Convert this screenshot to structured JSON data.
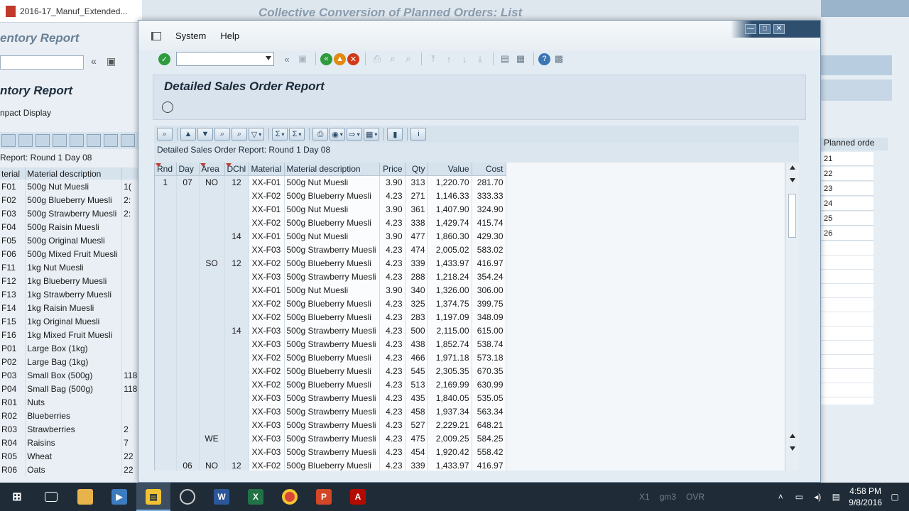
{
  "bg_left": {
    "pdf_tab_title": "2016-17_Manuf_Extended...",
    "title_inventory": "entory Report",
    "report_title": "ntory Report",
    "compact_display": "npact Display",
    "report_sub": "Report: Round 1 Day 08",
    "headers": [
      "terial",
      "Material description",
      ""
    ],
    "rows": [
      [
        "F01",
        "500g Nut Muesli",
        "1("
      ],
      [
        "F02",
        "500g Blueberry Muesli",
        "2:"
      ],
      [
        "F03",
        "500g Strawberry Muesli",
        "2:"
      ],
      [
        "F04",
        "500g Raisin Muesli",
        ""
      ],
      [
        "F05",
        "500g Original Muesli",
        ""
      ],
      [
        "F06",
        "500g Mixed Fruit Muesli",
        ""
      ],
      [
        "F11",
        "1kg Nut Muesli",
        ""
      ],
      [
        "F12",
        "1kg Blueberry Muesli",
        ""
      ],
      [
        "F13",
        "1kg Strawberry Muesli",
        ""
      ],
      [
        "F14",
        "1kg Raisin Muesli",
        ""
      ],
      [
        "F15",
        "1kg Original Muesli",
        ""
      ],
      [
        "F16",
        "1kg Mixed Fruit Muesli",
        ""
      ],
      [
        "P01",
        "Large Box (1kg)",
        ""
      ],
      [
        "P02",
        "Large Bag (1kg)",
        ""
      ],
      [
        "P03",
        "Small Box (500g)",
        "118"
      ],
      [
        "P04",
        "Small Bag (500g)",
        "118"
      ],
      [
        "R01",
        "Nuts",
        ""
      ],
      [
        "R02",
        "Blueberries",
        ""
      ],
      [
        "R03",
        "Strawberries",
        "2"
      ],
      [
        "R04",
        "Raisins",
        "7"
      ],
      [
        "R05",
        "Wheat",
        "22"
      ],
      [
        "R06",
        "Oats",
        "22"
      ]
    ]
  },
  "bg_top": {
    "title": "Collective Conversion of Planned Orders: List"
  },
  "bg_right": {
    "header": "Planned orde",
    "values": [
      "21",
      "22",
      "23",
      "24",
      "25",
      "26"
    ]
  },
  "dialog": {
    "menu": {
      "system": "System",
      "help": "Help"
    },
    "report_title": "Detailed Sales Order Report",
    "report_sub": "Detailed Sales Order Report: Round 1 Day 08",
    "columns": [
      "Rnd",
      "Day",
      "Area",
      "DChl",
      "Material",
      "Material description",
      "Price",
      "Qty",
      "Value",
      "Cost"
    ],
    "rows": [
      [
        "1",
        "07",
        "NO",
        "12",
        "XX-F01",
        "500g Nut Muesli",
        "3.90",
        "313",
        "1,220.70",
        "281.70"
      ],
      [
        "",
        "",
        "",
        "",
        "XX-F02",
        "500g Blueberry Muesli",
        "4.23",
        "271",
        "1,146.33",
        "333.33"
      ],
      [
        "",
        "",
        "",
        "",
        "XX-F01",
        "500g Nut Muesli",
        "3.90",
        "361",
        "1,407.90",
        "324.90"
      ],
      [
        "",
        "",
        "",
        "",
        "XX-F02",
        "500g Blueberry Muesli",
        "4.23",
        "338",
        "1,429.74",
        "415.74"
      ],
      [
        "",
        "",
        "",
        "14",
        "XX-F01",
        "500g Nut Muesli",
        "3.90",
        "477",
        "1,860.30",
        "429.30"
      ],
      [
        "",
        "",
        "",
        "",
        "XX-F03",
        "500g Strawberry Muesli",
        "4.23",
        "474",
        "2,005.02",
        "583.02"
      ],
      [
        "",
        "",
        "SO",
        "12",
        "XX-F02",
        "500g Blueberry Muesli",
        "4.23",
        "339",
        "1,433.97",
        "416.97"
      ],
      [
        "",
        "",
        "",
        "",
        "XX-F03",
        "500g Strawberry Muesli",
        "4.23",
        "288",
        "1,218.24",
        "354.24"
      ],
      [
        "",
        "",
        "",
        "",
        "XX-F01",
        "500g Nut Muesli",
        "3.90",
        "340",
        "1,326.00",
        "306.00"
      ],
      [
        "",
        "",
        "",
        "",
        "XX-F02",
        "500g Blueberry Muesli",
        "4.23",
        "325",
        "1,374.75",
        "399.75"
      ],
      [
        "",
        "",
        "",
        "",
        "XX-F02",
        "500g Blueberry Muesli",
        "4.23",
        "283",
        "1,197.09",
        "348.09"
      ],
      [
        "",
        "",
        "",
        "14",
        "XX-F03",
        "500g Strawberry Muesli",
        "4.23",
        "500",
        "2,115.00",
        "615.00"
      ],
      [
        "",
        "",
        "",
        "",
        "XX-F03",
        "500g Strawberry Muesli",
        "4.23",
        "438",
        "1,852.74",
        "538.74"
      ],
      [
        "",
        "",
        "",
        "",
        "XX-F02",
        "500g Blueberry Muesli",
        "4.23",
        "466",
        "1,971.18",
        "573.18"
      ],
      [
        "",
        "",
        "",
        "",
        "XX-F02",
        "500g Blueberry Muesli",
        "4.23",
        "545",
        "2,305.35",
        "670.35"
      ],
      [
        "",
        "",
        "",
        "",
        "XX-F02",
        "500g Blueberry Muesli",
        "4.23",
        "513",
        "2,169.99",
        "630.99"
      ],
      [
        "",
        "",
        "",
        "",
        "XX-F03",
        "500g Strawberry Muesli",
        "4.23",
        "435",
        "1,840.05",
        "535.05"
      ],
      [
        "",
        "",
        "",
        "",
        "XX-F03",
        "500g Strawberry Muesli",
        "4.23",
        "458",
        "1,937.34",
        "563.34"
      ],
      [
        "",
        "",
        "",
        "",
        "XX-F03",
        "500g Strawberry Muesli",
        "4.23",
        "527",
        "2,229.21",
        "648.21"
      ],
      [
        "",
        "",
        "WE",
        "",
        "XX-F03",
        "500g Strawberry Muesli",
        "4.23",
        "475",
        "2,009.25",
        "584.25"
      ],
      [
        "",
        "",
        "",
        "",
        "XX-F03",
        "500g Strawberry Muesli",
        "4.23",
        "454",
        "1,920.42",
        "558.42"
      ],
      [
        "",
        "06",
        "NO",
        "12",
        "XX-F02",
        "500g Blueberry Muesli",
        "4.23",
        "339",
        "1,433.97",
        "416.97"
      ]
    ]
  },
  "taskbar": {
    "status_x1": "X1",
    "status_server": "gm3",
    "status_mode": "OVR",
    "time": "4:58 PM",
    "date": "9/8/2016"
  },
  "colors": {
    "sap_title_bg": "#d8e3ee",
    "grid_key_bg": "#dde7f0",
    "taskbar_bg": "#1f2c38",
    "sort_marker": "#c0392b"
  }
}
